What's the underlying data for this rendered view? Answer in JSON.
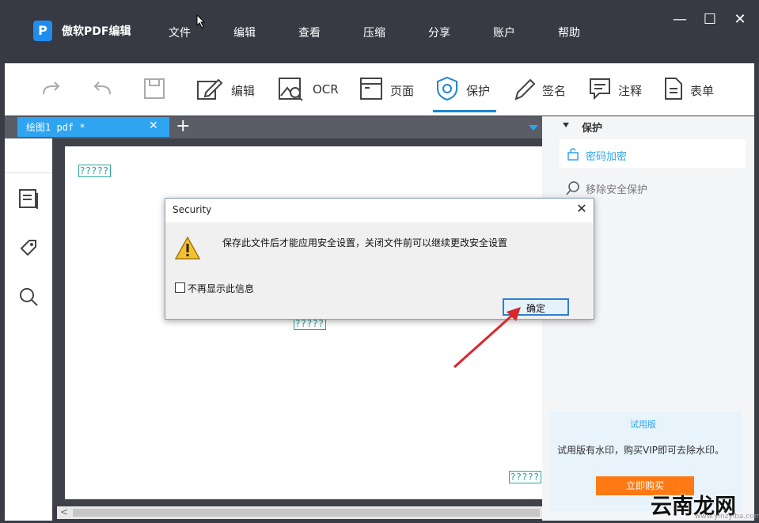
{
  "app": {
    "title": "傲软PDF编辑",
    "logo_letter": "P",
    "menu": [
      "文件",
      "编辑",
      "查看",
      "压缩",
      "分享",
      "账户",
      "帮助"
    ]
  },
  "window_controls": {
    "minimize": "—",
    "maximize": "☐",
    "close": "✕"
  },
  "toolbar": {
    "redo_icon": "redo-icon",
    "undo_icon": "undo-icon",
    "save_icon": "save-icon",
    "tools": [
      {
        "label": "编辑",
        "icon": "edit-icon"
      },
      {
        "label": "OCR",
        "icon": "ocr-icon"
      },
      {
        "label": "页面",
        "icon": "page-icon"
      },
      {
        "label": "保护",
        "icon": "shield-icon",
        "active": true
      },
      {
        "label": "签名",
        "icon": "pen-icon"
      },
      {
        "label": "注释",
        "icon": "comment-icon"
      },
      {
        "label": "表单",
        "icon": "form-icon"
      }
    ],
    "accent": "#1b86d4"
  },
  "tabs": {
    "doc_tab": "绘图1 pdf *",
    "close": "✕",
    "add": "+"
  },
  "document": {
    "placeholder_1": "?????",
    "placeholder_2": "?????",
    "placeholder_3": "?????"
  },
  "right_panel": {
    "heading": "保护",
    "items": [
      {
        "label": "密码加密",
        "icon": "lock-icon"
      },
      {
        "label": "移除安全保护",
        "icon": "search-icon"
      }
    ],
    "trial": {
      "title": "试用版",
      "text": "试用版有水印，购买VIP即可去除水印。",
      "button": "立即购买"
    }
  },
  "watermark": {
    "text": "云南龙网",
    "url": "www.ylnzyiba.com"
  },
  "dialog": {
    "title": "Security",
    "message": "保存此文件后才能应用安全设置，关闭文件前可以继续更改安全设置",
    "checkbox_label": "不再显示此信息",
    "ok": "确定",
    "close": "✕"
  },
  "colors": {
    "titlebar": "#373a43",
    "tab": "#2fa4f1",
    "buy_button": "#ff7a14",
    "arrow": "#d8262b"
  }
}
